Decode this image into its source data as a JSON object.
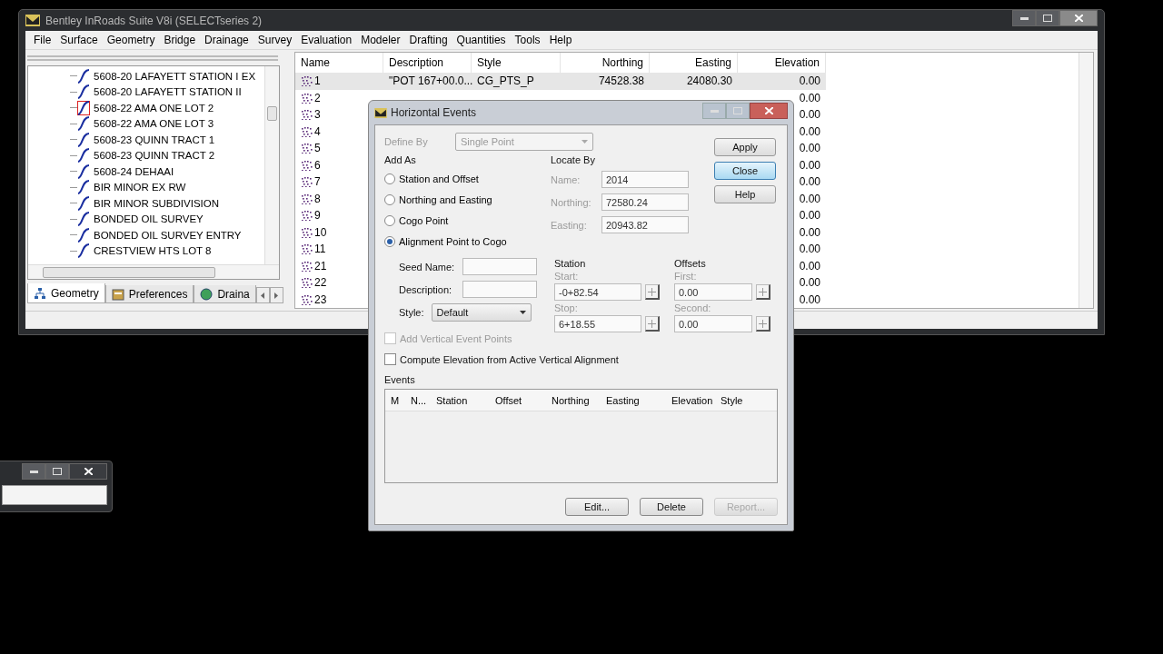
{
  "main_window": {
    "title": "Bentley InRoads Suite V8i (SELECTseries 2)",
    "menu": [
      "File",
      "Surface",
      "Geometry",
      "Bridge",
      "Drainage",
      "Survey",
      "Evaluation",
      "Modeler",
      "Drafting",
      "Quantities",
      "Tools",
      "Help"
    ],
    "tree": {
      "items": [
        {
          "label": "5608-20 LAFAYETT STATION I EX",
          "selected": false
        },
        {
          "label": "5608-20 LAFAYETT STATION II",
          "selected": false
        },
        {
          "label": "5608-22 AMA ONE LOT 2",
          "selected": true
        },
        {
          "label": "5608-22 AMA ONE LOT 3",
          "selected": false
        },
        {
          "label": "5608-23 QUINN TRACT 1",
          "selected": false
        },
        {
          "label": "5608-23 QUINN TRACT 2",
          "selected": false
        },
        {
          "label": "5608-24 DEHAAI",
          "selected": false
        },
        {
          "label": "BIR MINOR EX RW",
          "selected": false
        },
        {
          "label": "BIR MINOR SUBDIVISION",
          "selected": false
        },
        {
          "label": "BONDED OIL SURVEY",
          "selected": false
        },
        {
          "label": "BONDED OIL SURVEY ENTRY",
          "selected": false
        },
        {
          "label": "CRESTVIEW HTS LOT 8",
          "selected": false
        }
      ]
    },
    "panel_tabs": [
      {
        "label": "Geometry",
        "selected": true
      },
      {
        "label": "Preferences",
        "selected": false
      },
      {
        "label": "Draina",
        "selected": false
      }
    ],
    "list": {
      "columns": [
        "Name",
        "Description",
        "Style",
        "Northing",
        "Easting",
        "Elevation"
      ],
      "rows": [
        {
          "name": "1",
          "description": "\"POT 167+00.0...",
          "style": "CG_PTS_P",
          "northing": "74528.38",
          "easting": "24080.30",
          "elevation": "0.00",
          "selected": true
        },
        {
          "name": "2",
          "elevation": "0.00",
          "selected": false
        },
        {
          "name": "3",
          "elevation": "0.00",
          "selected": false
        },
        {
          "name": "4",
          "elevation": "0.00",
          "selected": false
        },
        {
          "name": "5",
          "elevation": "0.00",
          "selected": false
        },
        {
          "name": "6",
          "elevation": "0.00",
          "selected": false
        },
        {
          "name": "7",
          "elevation": "0.00",
          "selected": false
        },
        {
          "name": "8",
          "elevation": "0.00",
          "selected": false
        },
        {
          "name": "9",
          "elevation": "0.00",
          "selected": false
        },
        {
          "name": "10",
          "elevation": "0.00",
          "selected": false
        },
        {
          "name": "11",
          "elevation": "0.00",
          "selected": false
        },
        {
          "name": "21",
          "elevation": "0.00",
          "selected": false
        },
        {
          "name": "22",
          "elevation": "0.00",
          "selected": false
        },
        {
          "name": "23",
          "elevation": "0.00",
          "selected": false
        }
      ]
    }
  },
  "dialog": {
    "title": "Horizontal Events",
    "define_by": {
      "label": "Define By",
      "value": "Single Point",
      "disabled": true
    },
    "add_as": {
      "label": "Add As",
      "options": [
        {
          "label": "Station and Offset",
          "selected": false
        },
        {
          "label": "Northing and Easting",
          "selected": false
        },
        {
          "label": "Cogo Point",
          "selected": false
        },
        {
          "label": "Alignment Point to Cogo",
          "selected": true
        }
      ]
    },
    "seed_name": {
      "label": "Seed Name:"
    },
    "description": {
      "label": "Description:"
    },
    "style": {
      "label": "Style:",
      "value": "Default"
    },
    "add_vertical": {
      "label": "Add Vertical Event Points",
      "checked": false,
      "disabled": true
    },
    "locate_by": {
      "label": "Locate By",
      "fields": [
        {
          "label": "Name:",
          "value": "2014",
          "disabled": true
        },
        {
          "label": "Northing:",
          "value": "72580.24",
          "disabled": true
        },
        {
          "label": "Easting:",
          "value": "20943.82",
          "disabled": true
        }
      ]
    },
    "station": {
      "label": "Station",
      "fields": [
        {
          "label": "Start:",
          "value": "-0+82.54",
          "disabled": true
        },
        {
          "label": "Stop:",
          "value": "6+18.55",
          "disabled": true
        }
      ]
    },
    "offsets": {
      "label": "Offsets",
      "fields": [
        {
          "label": "First:",
          "value": "0.00",
          "disabled": true
        },
        {
          "label": "Second:",
          "value": "0.00",
          "disabled": true
        }
      ]
    },
    "side_buttons": [
      {
        "label": "Apply",
        "focused": false
      },
      {
        "label": "Close",
        "focused": true
      },
      {
        "label": "Help",
        "focused": false
      }
    ],
    "compute_elevation": {
      "label": "Compute Elevation from Active Vertical Alignment",
      "checked": false
    },
    "events": {
      "label": "Events",
      "columns": [
        "M",
        "N...",
        "Station",
        "Offset",
        "Northing",
        "Easting",
        "Elevation",
        "Style"
      ]
    },
    "bottom_buttons": [
      {
        "label": "Edit...",
        "disabled": false
      },
      {
        "label": "Delete",
        "disabled": false
      },
      {
        "label": "Report...",
        "disabled": true
      }
    ]
  }
}
